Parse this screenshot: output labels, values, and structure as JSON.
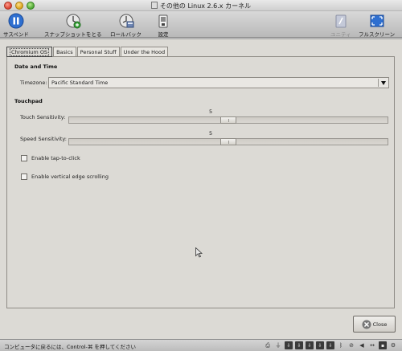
{
  "window": {
    "title": "その他の Linux 2.6.x カーネル"
  },
  "toolbar": {
    "suspend_label": "サスペンド",
    "snapshot_label": "スナップショットをとる",
    "rollback_label": "ロールバック",
    "settings_label": "設定",
    "unity_label": "ユニティ",
    "fullscreen_label": "フルスクリーン"
  },
  "tabs": [
    {
      "label": "Chromium OS"
    },
    {
      "label": "Basics"
    },
    {
      "label": "Personal Stuff"
    },
    {
      "label": "Under the Hood"
    }
  ],
  "date_time": {
    "section_title": "Date and Time",
    "timezone_label": "Timezone:",
    "timezone_value": "Pacific Standard Time"
  },
  "touchpad": {
    "section_title": "Touchpad",
    "touch_label": "Touch Sensitivity:",
    "touch_value": "5",
    "touch_fraction": 0.5,
    "speed_label": "Speed Sensitivity:",
    "speed_value": "5",
    "speed_fraction": 0.5,
    "tap_to_click_label": "Enable tap-to-click",
    "tap_to_click_checked": false,
    "vertical_scroll_label": "Enable vertical edge scrolling",
    "vertical_scroll_checked": false
  },
  "dialog": {
    "close_label": "Close"
  },
  "status": {
    "text": "コンピュータに戻るには、Control-⌘ を押してください"
  },
  "colors": {
    "dialog_bg": "#dcdad5",
    "toolbar_bg": "#c9c9c9"
  }
}
